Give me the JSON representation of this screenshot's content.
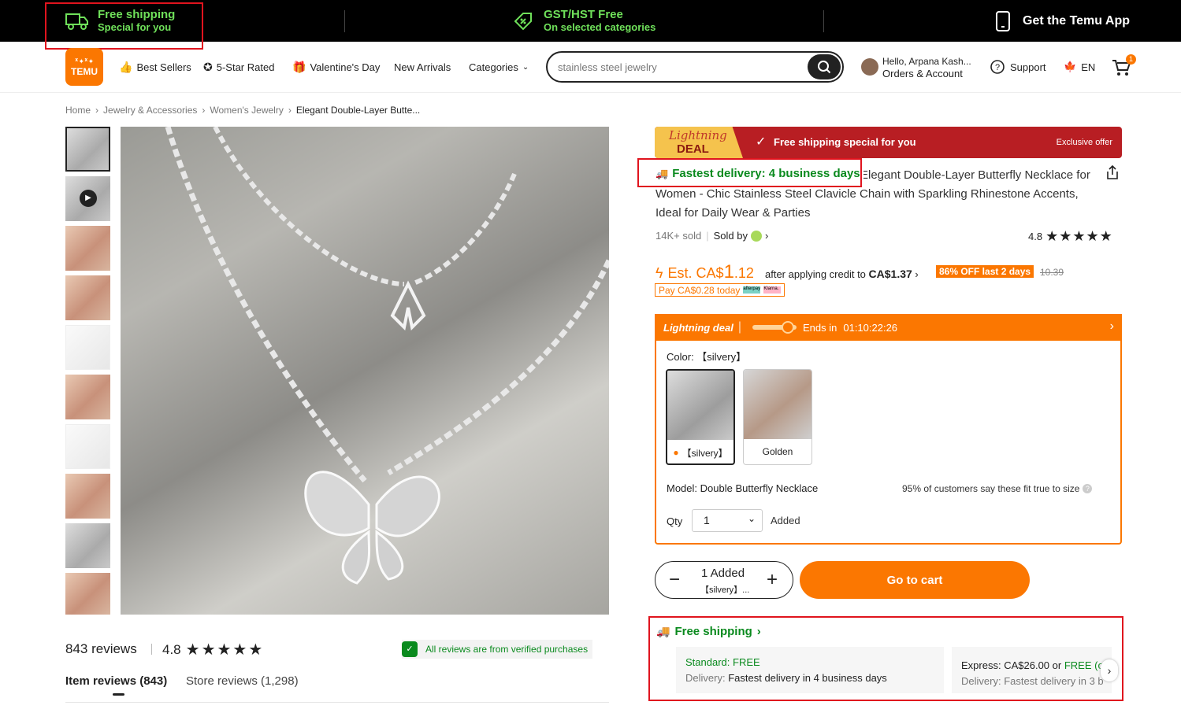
{
  "promo": {
    "free_shipping_title": "Free shipping",
    "free_shipping_sub": "Special for you",
    "gst_title": "GST/HST Free",
    "gst_sub": "On selected categories",
    "app_label": "Get the Temu App"
  },
  "header": {
    "logo_top": "ᕽ✦ᕽ✦",
    "logo_text": "TEMU",
    "nav": [
      "Best Sellers",
      "5-Star Rated",
      "Valentine's Day",
      "New Arrivals",
      "Categories"
    ],
    "search_placeholder": "stainless steel jewelry",
    "greeting": "Hello, Arpana Kash...",
    "account": "Orders & Account",
    "support": "Support",
    "language": "EN",
    "cart_count": "1"
  },
  "breadcrumb": [
    "Home",
    "Jewelry & Accessories",
    "Women's Jewelry",
    "Elegant Double-Layer Butte..."
  ],
  "reviews": {
    "count": "843 reviews",
    "rating": "4.8",
    "verified": "All reviews are from verified purchases",
    "tab_item": "Item reviews (843)",
    "tab_store": "Store reviews (1,298)"
  },
  "deal": {
    "lightning1": "Lightning",
    "lightning2": "DEAL",
    "message": "Free shipping special for you",
    "exclusive": "Exclusive offer"
  },
  "product": {
    "fastest": "Fastest delivery: 4 business days",
    "title": "Elegant Double-Layer Butterfly Necklace for Women - Chic Stainless Steel Clavicle Chain with Sparkling Rhinestone Accents, Ideal for Daily Wear & Parties",
    "sold": "14K+ sold",
    "sold_by": "Sold by",
    "rating": "4.8",
    "est_label": "Est. CA$",
    "est_big": "1",
    "est_small": ".12",
    "after_text": "after applying credit to",
    "after_price": "CA$1.37",
    "off_badge": "86% OFF last 2 days",
    "orig_price": "10.39",
    "pay_today": "Pay CA$0.28 today",
    "pay_badge1": "afterpay",
    "pay_badge2": "Klarna."
  },
  "lightning_deal": {
    "title": "Lightning deal",
    "ends_label": "Ends in",
    "countdown": "01:10:22:26"
  },
  "options": {
    "color_label": "Color: 【silvery】",
    "swatches": [
      "【silvery】",
      "Golden"
    ],
    "model": "Model: Double Butterfly Necklace",
    "fit": "95% of customers say these fit true to size",
    "qty_label": "Qty",
    "qty_value": "1",
    "added": "Added"
  },
  "cart_controls": {
    "added_line1": "1 Added",
    "added_line2": "【silvery】...",
    "go_to_cart": "Go to cart"
  },
  "shipping": {
    "title": "Free shipping",
    "standard_label": "Standard:",
    "standard_value": "FREE",
    "standard_delivery_label": "Delivery:",
    "standard_delivery": "Fastest delivery in 4 business days",
    "express_label": "Express:",
    "express_value": "CA$26.00 or",
    "express_free": "FREE (o",
    "express_delivery_label": "Delivery:",
    "express_delivery": "Fastest delivery in 3 b"
  },
  "colors": {
    "brand_orange": "#fb7701",
    "deal_red": "#b81e23",
    "green": "#0a8a1e",
    "annotation_red": "#e0141e"
  }
}
